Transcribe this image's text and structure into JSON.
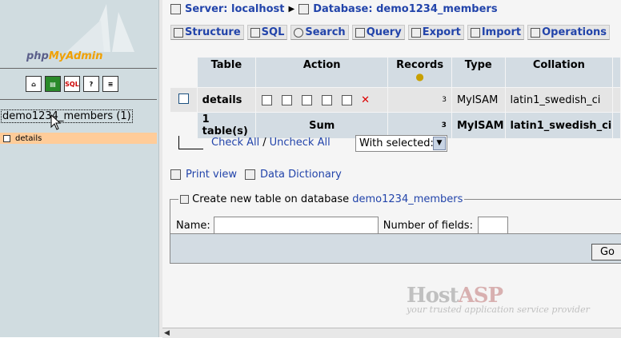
{
  "sidebar": {
    "logo_php": "php",
    "logo_myadmin": "MyAdmin",
    "quick_icons": [
      "home-icon",
      "query-window-icon",
      "sql-icon",
      "help-icon",
      "docs-icon"
    ],
    "database_label": "demo1234_members (1)",
    "tables": [
      {
        "label": "details"
      }
    ]
  },
  "breadcrumb": {
    "server": "Server: localhost",
    "database": "Database: demo1234_members"
  },
  "tabs": [
    {
      "label": "Structure",
      "icon": "structure-icon"
    },
    {
      "label": "SQL",
      "icon": "sql-icon"
    },
    {
      "label": "Search",
      "icon": "search-icon"
    },
    {
      "label": "Query",
      "icon": "query-icon"
    },
    {
      "label": "Export",
      "icon": "export-icon"
    },
    {
      "label": "Import",
      "icon": "import-icon"
    },
    {
      "label": "Operations",
      "icon": "operations-icon"
    }
  ],
  "table": {
    "headers": [
      "Table",
      "Action",
      "Records",
      "Type",
      "Collation"
    ],
    "rows": [
      {
        "name": "details",
        "records": "3",
        "type": "MyISAM",
        "collation": "latin1_swedish_ci"
      }
    ],
    "sum": {
      "label": "1 table(s)",
      "sum_label": "Sum",
      "records": "3",
      "type": "MyISAM",
      "collation": "latin1_swedish_ci"
    }
  },
  "actions": {
    "check_all": "Check All",
    "separator": "/",
    "uncheck_all": "Uncheck All",
    "with_selected": "With selected:"
  },
  "links": {
    "print_view": "Print view",
    "data_dictionary": "Data Dictionary"
  },
  "create_table": {
    "legend_prefix": "Create new table on database",
    "db_link": "demo1234_members",
    "name_label": "Name:",
    "fields_label": "Number of fields:",
    "go_button": "Go"
  },
  "watermark": {
    "brand_a": "Host",
    "brand_b": "ASP",
    "tagline": "your trusted application service provider"
  }
}
